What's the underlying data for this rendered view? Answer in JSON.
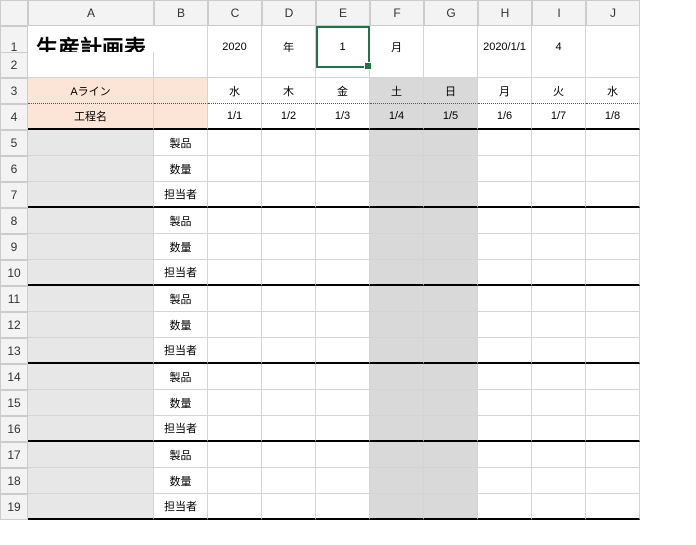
{
  "columns": [
    "A",
    "B",
    "C",
    "D",
    "E",
    "F",
    "G",
    "H",
    "I",
    "J"
  ],
  "rows": [
    "1",
    "2",
    "3",
    "4",
    "5",
    "6",
    "7",
    "8",
    "9",
    "10",
    "11",
    "12",
    "13",
    "14",
    "15",
    "16",
    "17",
    "18",
    "19"
  ],
  "title": "生産計画表",
  "header": {
    "year_value": "2020",
    "year_label": "年",
    "month_value": "1",
    "month_label": "月",
    "date_text": "2020/1/1",
    "count": "4"
  },
  "row3": {
    "line_label": "Aライン",
    "days": [
      "水",
      "木",
      "金",
      "土",
      "日",
      "月",
      "火",
      "水"
    ]
  },
  "row4": {
    "process_label": "工程名",
    "dates": [
      "1/1",
      "1/2",
      "1/3",
      "1/4",
      "1/5",
      "1/6",
      "1/7",
      "1/8"
    ]
  },
  "field_labels": {
    "product": "製品",
    "qty": "数量",
    "person": "担当者"
  },
  "selected_cell": "E1",
  "chart_data": {
    "type": "table",
    "title": "生産計画表",
    "period": {
      "year": 2020,
      "month": 1,
      "start_date": "2020/1/1",
      "days_rendered": 8
    },
    "columns": [
      {
        "date": "1/1",
        "weekday": "水"
      },
      {
        "date": "1/2",
        "weekday": "木"
      },
      {
        "date": "1/3",
        "weekday": "金"
      },
      {
        "date": "1/4",
        "weekday": "土",
        "weekend": true
      },
      {
        "date": "1/5",
        "weekday": "日",
        "weekend": true
      },
      {
        "date": "1/6",
        "weekday": "月"
      },
      {
        "date": "1/7",
        "weekday": "火"
      },
      {
        "date": "1/8",
        "weekday": "水"
      }
    ],
    "line": "Aライン",
    "process_blocks": 5,
    "rows_per_process": [
      "製品",
      "数量",
      "担当者"
    ],
    "header_extra_number": 4
  }
}
